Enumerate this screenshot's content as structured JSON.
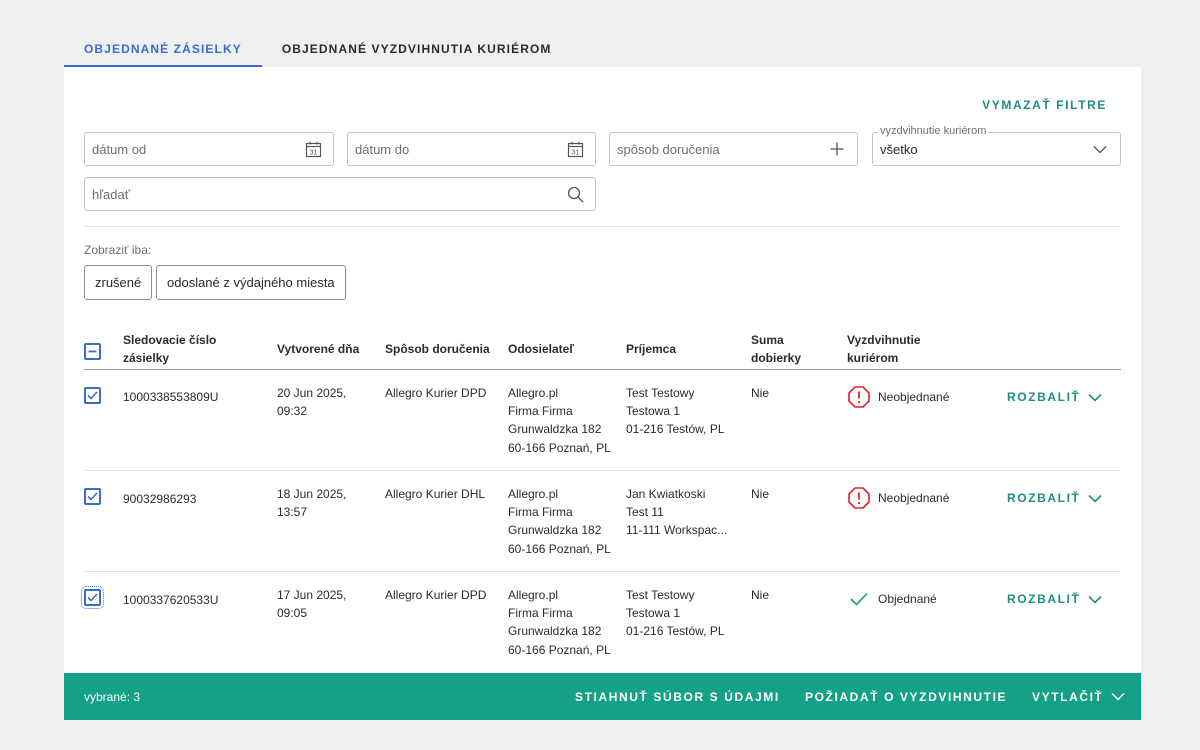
{
  "tabs": [
    {
      "label": "OBJEDNANÉ ZÁSIELKY",
      "active": true
    },
    {
      "label": "OBJEDNANÉ VYZDVIHNUTIA KURIÉROM",
      "active": false
    }
  ],
  "filters": {
    "clear_label": "VYMAZAŤ FILTRE",
    "date_from_placeholder": "dátum od",
    "date_to_placeholder": "dátum do",
    "delivery_placeholder": "spôsob doručenia",
    "pickup_legend": "vyzdvihnutie kuriérom",
    "pickup_value": "všetko",
    "search_placeholder": "hľadať",
    "calendar_day": "31"
  },
  "show_only": {
    "label": "Zobraziť iba:",
    "chips": [
      "zrušené",
      "odoslané z výdajného miesta"
    ]
  },
  "table": {
    "headers": {
      "tracking": "Sledovacie číslo zásielky",
      "created": "Vytvorené dňa",
      "delivery": "Spôsob doručenia",
      "sender": "Odosielateľ",
      "recipient": "Príjemca",
      "cod": "Suma dobierky",
      "pickup": "Vyzdvihnutie kuriérom"
    },
    "rows": [
      {
        "checked": true,
        "tracking": "1000338553809U",
        "created_date": "20 Jun 2025,",
        "created_time": "09:32",
        "delivery": "Allegro Kurier DPD",
        "sender": [
          "Allegro.pl",
          "Firma Firma",
          "Grunwaldzka 182",
          "60-166 Poznań, PL"
        ],
        "recipient": [
          "Test Testowy",
          "Testowa 1",
          "01-216 Testów, PL"
        ],
        "cod": "Nie",
        "status": "Neobjednané",
        "status_type": "warning",
        "expand": "ROZBALIŤ"
      },
      {
        "checked": true,
        "tracking": "90032986293",
        "created_date": "18 Jun 2025,",
        "created_time": "13:57",
        "delivery": "Allegro Kurier DHL",
        "sender": [
          "Allegro.pl",
          "Firma Firma",
          "Grunwaldzka 182",
          "60-166 Poznań, PL"
        ],
        "recipient": [
          "Jan Kwiatkoski",
          "Test 11",
          "11-111 Workspac..."
        ],
        "cod": "Nie",
        "status": "Neobjednané",
        "status_type": "warning",
        "expand": "ROZBALIŤ"
      },
      {
        "checked": true,
        "tracking": "1000337620533U",
        "created_date": "17 Jun 2025,",
        "created_time": "09:05",
        "delivery": "Allegro Kurier DPD",
        "sender": [
          "Allegro.pl",
          "Firma Firma",
          "Grunwaldzka 182",
          "60-166 Poznań, PL"
        ],
        "recipient": [
          "Test Testowy",
          "Testowa 1",
          "01-216 Testów, PL"
        ],
        "cod": "Nie",
        "status": "Objednané",
        "status_type": "ok",
        "expand": "ROZBALIŤ"
      }
    ]
  },
  "footer": {
    "selected": "vybrané: 3",
    "download": "STIAHNUŤ SÚBOR S ÚDAJMI",
    "request_pickup": "POŽIADAŤ O VYZDVIHNUTIE",
    "print": "VYTLAČIŤ"
  },
  "colors": {
    "accent_blue": "#3b6cc9",
    "accent_green": "#1f8f7e",
    "footer_green": "#15a088",
    "warning_red": "#e0202e",
    "ok_green": "#1d9a52"
  },
  "icons": {
    "date_field": "calendar-icon",
    "delivery_field": "plus-icon",
    "pickup_field": "chevron-down-icon",
    "search_field": "search-icon",
    "header_checkbox": "checkbox-indeterminate-icon",
    "row_checkbox": "checkbox-checked-icon",
    "warning_status": "alert-octagon-icon",
    "ok_status": "check-icon",
    "expand": "chevron-down-icon"
  }
}
